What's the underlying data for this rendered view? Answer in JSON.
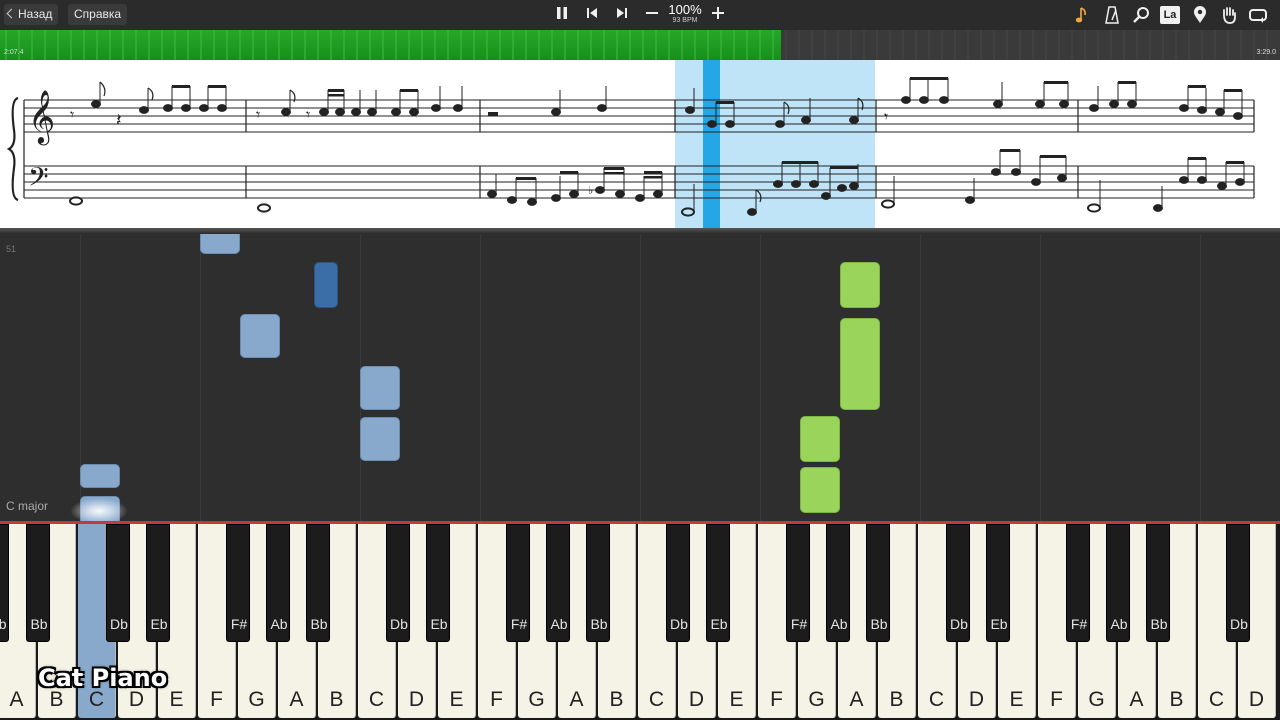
{
  "toolbar": {
    "back_label": "Назад",
    "help_label": "Справка",
    "speed_percent": "100%",
    "tempo": "93 BPM",
    "icons": [
      "pause-icon",
      "skip-back-icon",
      "skip-forward-icon",
      "minus-icon",
      "plus-icon",
      "note-icon",
      "metronome-icon",
      "magnifier-icon",
      "label-icon",
      "pin-icon",
      "hand-icon",
      "loop-icon"
    ],
    "label_icon_text": "La"
  },
  "progress": {
    "elapsed": "2:07.4",
    "total": "3:29.0",
    "fraction": 0.61
  },
  "piano_roll": {
    "measure_number": "51",
    "key_label": "C major"
  },
  "keyboard": {
    "white_keys": [
      "A",
      "B",
      "C",
      "D",
      "E",
      "F",
      "G",
      "A",
      "B",
      "C",
      "D",
      "E",
      "F",
      "G",
      "A",
      "B",
      "C",
      "D",
      "E",
      "F",
      "G",
      "A",
      "B",
      "C",
      "D",
      "E",
      "F",
      "G",
      "A",
      "B",
      "C",
      "D"
    ],
    "black_keys": [
      "Bb",
      "Db",
      "Eb",
      "F#",
      "Ab",
      "Bb",
      "Db",
      "Eb",
      "F#",
      "Ab",
      "Bb",
      "Db",
      "Eb",
      "F#",
      "Ab",
      "Bb",
      "Db",
      "Eb",
      "F#",
      "Ab",
      "Bb",
      "Db"
    ],
    "leading_black_key": "Bb",
    "pressed_key": "C"
  },
  "watermark": "Cat Piano",
  "colors": {
    "progress": "#1f9d21",
    "highlight": "#bfe3f7",
    "cursor": "#25a6e6",
    "left_hand_notes": "#88a9cc",
    "right_hand_notes": "#9bd45a"
  }
}
